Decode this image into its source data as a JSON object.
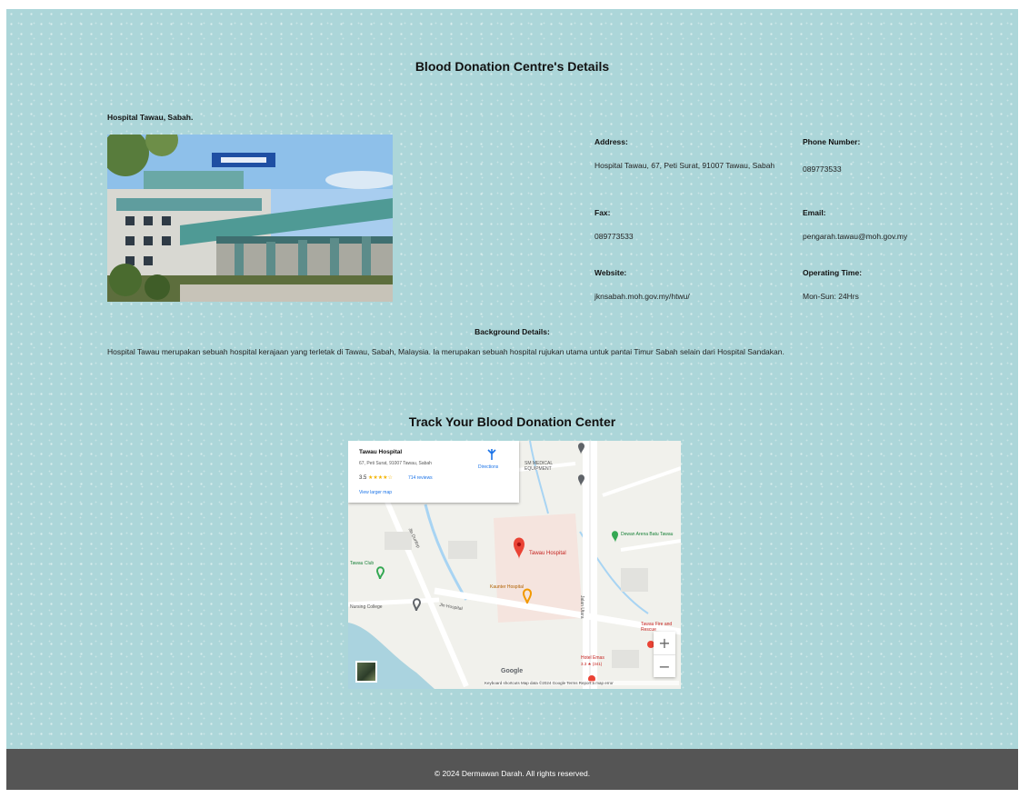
{
  "page": {
    "title": "Blood Donation Centre's Details"
  },
  "centre": {
    "name": "Hospital Tawau, Sabah."
  },
  "info": {
    "address_label": "Address:",
    "address_value": "Hospital Tawau, 67, Peti Surat, 91007 Tawau, Sabah",
    "phone_label": "Phone Number:",
    "phone_value": "089773533",
    "fax_label": "Fax:",
    "fax_value": "089773533",
    "email_label": "Email:",
    "email_value": "pengarah.tawau@moh.gov.my",
    "website_label": "Website:",
    "website_value": "jknsabah.moh.gov.my/htwu/",
    "hours_label": "Operating Time:",
    "hours_value": "Mon-Sun: 24Hrs"
  },
  "background": {
    "title": "Background Details:",
    "text": "Hospital Tawau merupakan sebuah hospital kerajaan yang terletak di Tawau, Sabah, Malaysia. Ia merupakan sebuah hospital rujukan utama untuk pantai Timur Sabah selain dari Hospital Sandakan."
  },
  "tracker": {
    "title": "Track Your Blood Donation Center",
    "card": {
      "title": "Tawau Hospital",
      "address": "67, Peti Surat, 91007 Tawau, Sabah",
      "rating": "3.5",
      "stars": "★★★★☆",
      "reviews": "714 reviews",
      "larger_map": "View larger map",
      "directions": "Directions"
    },
    "labels": {
      "hospital": "Tawau Hospital",
      "kaunter": "Kaunter Hospital",
      "medical": "SM MEDICAL EQUIPMENT",
      "dewan": "Dewan Arena Batu Tawau",
      "club": "Tawau Club",
      "nursing": "Nursing College",
      "fire": "Tawau Fire and Rescue",
      "hotel": "Hotel Emas",
      "hotel_rating": "3.3 ★ (341)",
      "road_jalan_utara": "Jalan Utara",
      "road_hospital": "Jln Hospital",
      "road_dunlop": "Jln Dunlop",
      "google": "Google",
      "zoom_in": "+",
      "zoom_out": "−",
      "attribution": "Keyboard shortcuts    Map data ©2024 Google    Terms    Report a map error"
    },
    "colors": {
      "marker_red": "#ea4335",
      "marker_orange": "#f29900",
      "marker_green": "#34a853",
      "marker_grey": "#5f6368"
    }
  },
  "footer": {
    "text": "© 2024 Dermawan Darah. All rights reserved."
  }
}
